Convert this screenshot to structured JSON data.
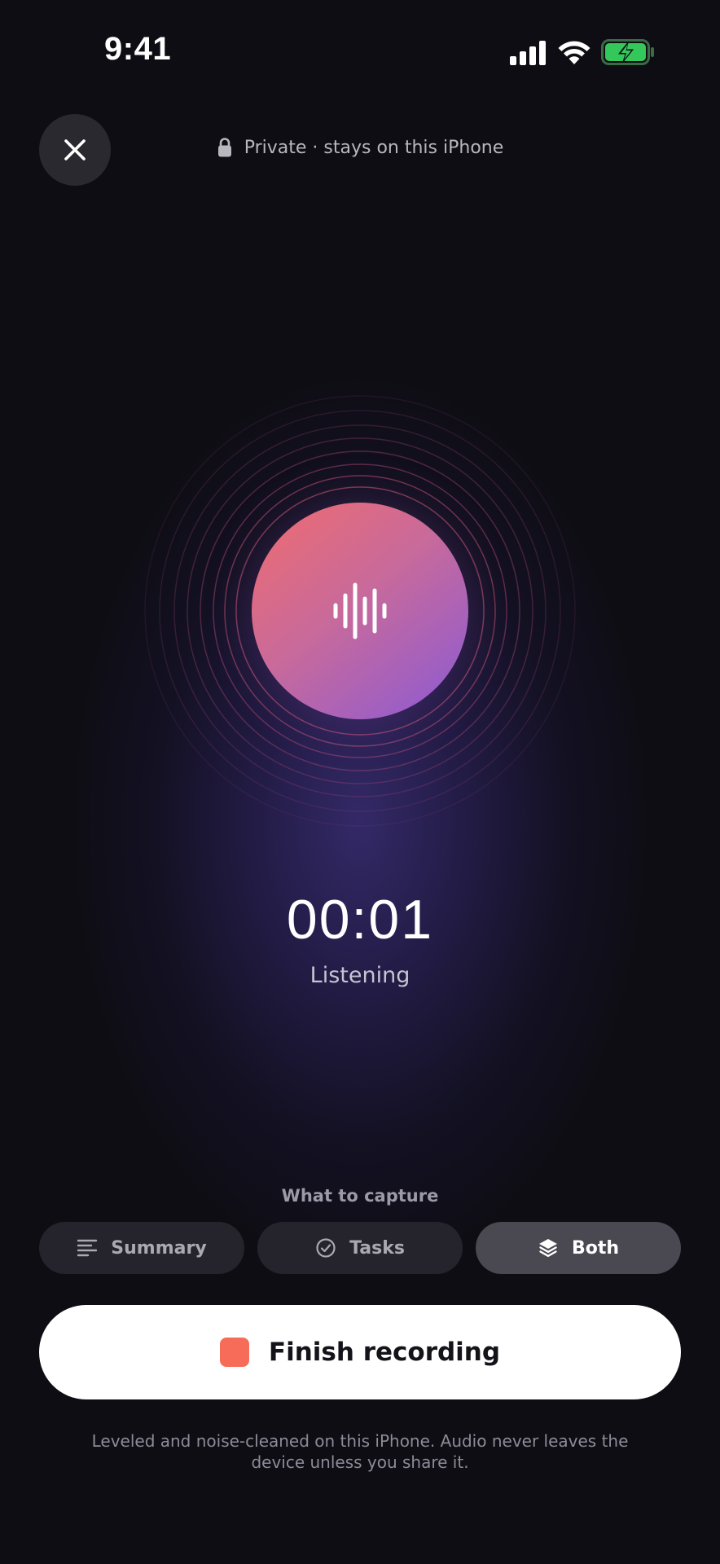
{
  "status_bar": {
    "time": "9:41",
    "icons": [
      "signal-icon",
      "wifi-icon",
      "battery-charging-icon"
    ],
    "battery_color": "#34c759"
  },
  "header": {
    "close_icon": "close-icon",
    "lock_icon": "lock-icon",
    "privacy_text": "Private · stays on this iPhone"
  },
  "recorder": {
    "orb_icon": "waveform-icon",
    "orb_gradient": [
      "#f06c6e",
      "#c96a9a",
      "#8a5ad6"
    ],
    "timer": "00:01",
    "status": "Listening"
  },
  "capture": {
    "label": "What to capture",
    "options": [
      {
        "label": "Summary",
        "icon": "summary-lines-icon",
        "selected": false
      },
      {
        "label": "Tasks",
        "icon": "check-circle-icon",
        "selected": false
      },
      {
        "label": "Both",
        "icon": "layers-icon",
        "selected": true
      }
    ]
  },
  "finish": {
    "label": "Finish recording",
    "icon": "stop-square-icon",
    "accent": "#f76b59"
  },
  "footnote": "Leveled and noise-cleaned on this iPhone. Audio never leaves the device unless you share it."
}
